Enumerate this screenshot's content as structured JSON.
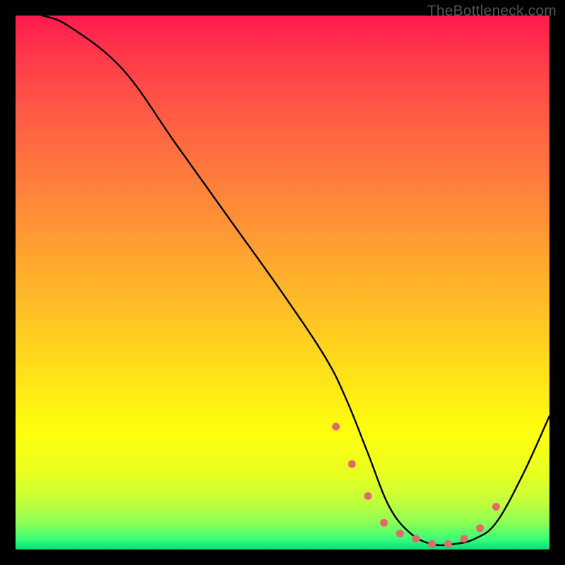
{
  "watermark": "TheBottleneck.com",
  "chart_data": {
    "type": "line",
    "title": "",
    "xlabel": "",
    "ylabel": "",
    "xlim": [
      0,
      100
    ],
    "ylim": [
      0,
      100
    ],
    "series": [
      {
        "name": "bottleneck-curve",
        "x": [
          5,
          10,
          20,
          30,
          40,
          50,
          58,
          62,
          66,
          70,
          74,
          78,
          82,
          86,
          90,
          95,
          100
        ],
        "values": [
          100,
          98,
          90,
          76,
          62,
          48,
          36,
          28,
          18,
          8,
          3,
          1,
          1,
          2,
          5,
          14,
          25
        ]
      }
    ],
    "markers": {
      "name": "optimal-range-dots",
      "color": "#e26a6a",
      "x": [
        60,
        63,
        66,
        69,
        72,
        75,
        78,
        81,
        84,
        87,
        90
      ],
      "values": [
        23,
        16,
        10,
        5,
        3,
        2,
        1,
        1,
        2,
        4,
        8
      ]
    }
  }
}
